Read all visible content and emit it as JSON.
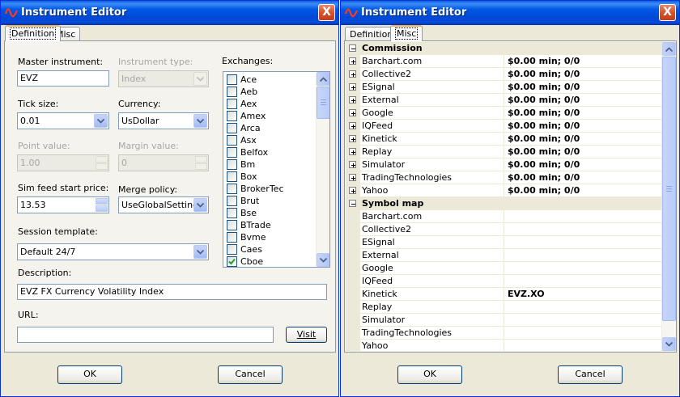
{
  "left": {
    "title": "Instrument Editor",
    "close": "X",
    "tabs": [
      "Definition",
      "Misc"
    ],
    "master_instrument": {
      "label": "Master instrument:",
      "value": "EVZ"
    },
    "instrument_type": {
      "label": "Instrument type:",
      "value": "Index"
    },
    "exchanges": {
      "label": "Exchanges:",
      "items": [
        {
          "name": "Ace",
          "checked": false
        },
        {
          "name": "Aeb",
          "checked": false
        },
        {
          "name": "Aex",
          "checked": false
        },
        {
          "name": "Amex",
          "checked": false
        },
        {
          "name": "Arca",
          "checked": false
        },
        {
          "name": "Asx",
          "checked": false
        },
        {
          "name": "Belfox",
          "checked": false
        },
        {
          "name": "Bm",
          "checked": false
        },
        {
          "name": "Box",
          "checked": false
        },
        {
          "name": "BrokerTec",
          "checked": false
        },
        {
          "name": "Brut",
          "checked": false
        },
        {
          "name": "Bse",
          "checked": false
        },
        {
          "name": "BTrade",
          "checked": false
        },
        {
          "name": "Bvme",
          "checked": false
        },
        {
          "name": "Caes",
          "checked": false
        },
        {
          "name": "Cboe",
          "checked": true
        }
      ]
    },
    "tick_size": {
      "label": "Tick size:",
      "value": "0.01"
    },
    "currency": {
      "label": "Currency:",
      "value": "UsDollar"
    },
    "point_value": {
      "label": "Point value:",
      "value": "1.00"
    },
    "margin_value": {
      "label": "Margin value:",
      "value": "0"
    },
    "sim_feed": {
      "label": "Sim feed start price:",
      "value": "13.53"
    },
    "merge_policy": {
      "label": "Merge policy:",
      "value": "UseGlobalSettings"
    },
    "session_template": {
      "label": "Session template:",
      "value": "Default 24/7"
    },
    "description": {
      "label": "Description:",
      "value": "EVZ FX Currency Volatility Index"
    },
    "url": {
      "label": "URL:",
      "value": ""
    },
    "visit": "Visit",
    "ok": "OK",
    "cancel": "Cancel"
  },
  "right": {
    "title": "Instrument Editor",
    "close": "X",
    "tabs": [
      "Definition",
      "Misc"
    ],
    "commission": {
      "header": "Commission",
      "rows": [
        {
          "name": "Barchart.com",
          "value": "$0.00 min;  0/0"
        },
        {
          "name": "Collective2",
          "value": "$0.00 min;  0/0"
        },
        {
          "name": "ESignal",
          "value": "$0.00 min;  0/0"
        },
        {
          "name": "External",
          "value": "$0.00 min;  0/0"
        },
        {
          "name": "Google",
          "value": "$0.00 min;  0/0"
        },
        {
          "name": "IQFeed",
          "value": "$0.00 min;  0/0"
        },
        {
          "name": "Kinetick",
          "value": "$0.00 min;  0/0"
        },
        {
          "name": "Replay",
          "value": "$0.00 min;  0/0"
        },
        {
          "name": "Simulator",
          "value": "$0.00 min;  0/0"
        },
        {
          "name": "TradingTechnologies",
          "value": "$0.00 min;  0/0"
        },
        {
          "name": "Yahoo",
          "value": "$0.00 min;  0/0"
        }
      ]
    },
    "symbol_map": {
      "header": "Symbol map",
      "rows": [
        {
          "name": "Barchart.com",
          "value": ""
        },
        {
          "name": "Collective2",
          "value": ""
        },
        {
          "name": "ESignal",
          "value": ""
        },
        {
          "name": "External",
          "value": ""
        },
        {
          "name": "Google",
          "value": ""
        },
        {
          "name": "IQFeed",
          "value": ""
        },
        {
          "name": "Kinetick",
          "value": "EVZ.XO"
        },
        {
          "name": "Replay",
          "value": ""
        },
        {
          "name": "Simulator",
          "value": ""
        },
        {
          "name": "TradingTechnologies",
          "value": ""
        },
        {
          "name": "Yahoo",
          "value": ""
        }
      ]
    },
    "ok": "OK",
    "cancel": "Cancel"
  },
  "colors": {
    "title_bar": "#0054e3",
    "close_button": "#d8522b",
    "dialog_face": "#ece9d8",
    "active_tab_accent": "#f5b24a"
  }
}
